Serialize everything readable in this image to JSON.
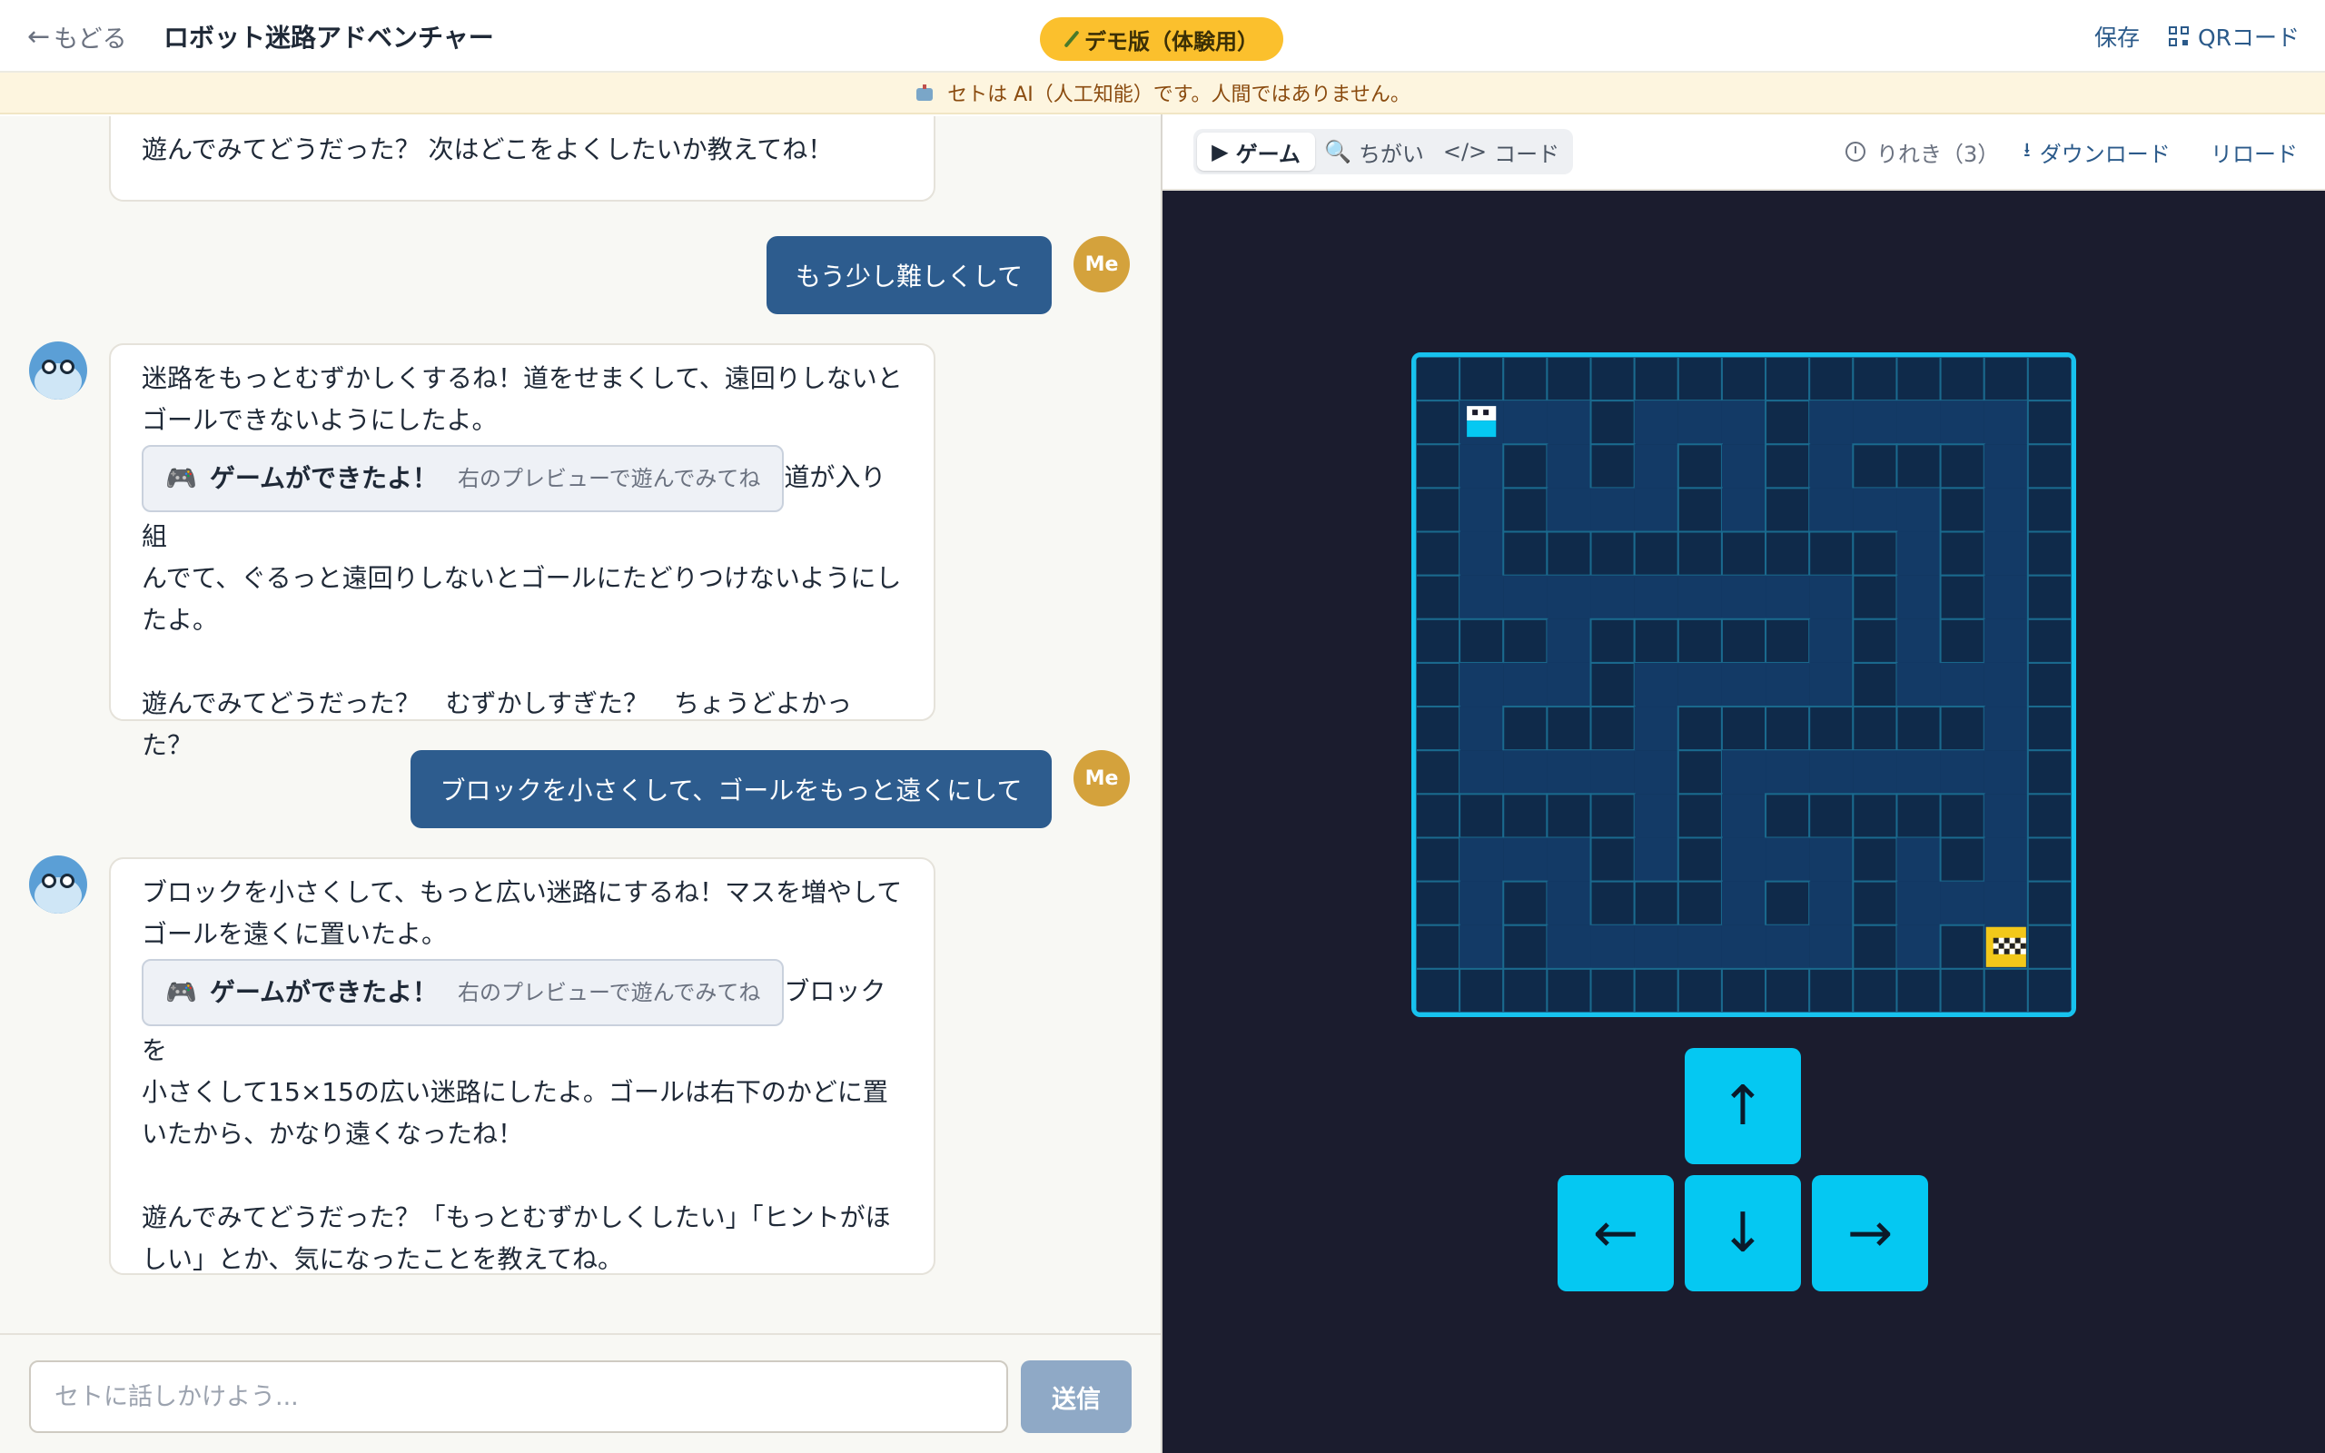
{
  "header": {
    "back_label": "もどる",
    "title": "ロボット迷路アドベンチャー",
    "demo_badge": "デモ版（体験用）",
    "save_label": "保存",
    "qr_label": "QRコード"
  },
  "notice": {
    "text": "セトは AI（人工知能）です。人間ではありません。"
  },
  "chat": {
    "messages": [
      {
        "from": "ai",
        "text": "遊んでみてどうだった？ 次はどこをよくしたいか教えてね！"
      },
      {
        "from": "me",
        "avatar": "Me",
        "text": "もう少し難しくして"
      },
      {
        "from": "ai",
        "intro": "迷路をもっとむずかしくするね！道をせまくして、遠回りしないとゴールできないようにしたよ。",
        "chip_title": "ゲームができたよ！",
        "chip_sub": "右のプレビューで遊んでみてね",
        "after_chip_1": "道が入り組",
        "after_chip_2": "んでて、ぐるっと遠回りしないとゴールにたどりつけないようにし",
        "after_chip_3": "たよ。",
        "question": "遊んでみてどうだった？　むずかしすぎた？　ちょうどよかった？"
      },
      {
        "from": "me",
        "avatar": "Me",
        "text": "ブロックを小さくして、ゴールをもっと遠くにして"
      },
      {
        "from": "ai",
        "intro": "ブロックを小さくして、もっと広い迷路にするね！マスを増やしてゴールを遠くに置いたよ。",
        "chip_title": "ゲームができたよ！",
        "chip_sub": "右のプレビューで遊んでみてね",
        "after_chip_1": "ブロックを",
        "after_chip_2": "小さくして15×15の広い迷路にしたよ。ゴールは右下のかどに置",
        "after_chip_3": "いたから、かなり遠くなったね！",
        "question_1": "遊んでみてどうだった？「もっとむずかしくしたい」「ヒントがほ",
        "question_2": "しい」とか、気になったことを教えてね。"
      }
    ]
  },
  "composer": {
    "placeholder": "セトに話しかけよう...",
    "send_label": "送信"
  },
  "preview": {
    "tabs": [
      {
        "icon": "▶",
        "label": "ゲーム",
        "active": true
      },
      {
        "icon": "🔍",
        "label": "ちがい",
        "active": false
      },
      {
        "icon": "</>",
        "label": "コード",
        "active": false
      }
    ],
    "history_label": "りれき（3）",
    "download_label": "ダウンロード",
    "reload_label": "リロード"
  },
  "game": {
    "grid_size": 15,
    "player": {
      "row": 1,
      "col": 1
    },
    "goal": {
      "row": 13,
      "col": 13
    },
    "walls": [
      "111111111111111",
      "100010001000001",
      "101010101011101",
      "101000101000101",
      "101111111110101",
      "100000000010101",
      "111011111010101",
      "100010000010001",
      "101110111111101",
      "100000100000001",
      "111110101111101",
      "100010100010101",
      "101011101010001",
      "101000000010101",
      "111111111111111"
    ],
    "controls": {
      "up": "↑",
      "down": "↓",
      "left": "←",
      "right": "→"
    },
    "colors": {
      "wall": "#0f2a4a",
      "path": "#133a66",
      "grid": "#1a6a8e",
      "border": "#17c2ee",
      "player": "#05c8f2",
      "goal": "#f2c81a"
    }
  }
}
